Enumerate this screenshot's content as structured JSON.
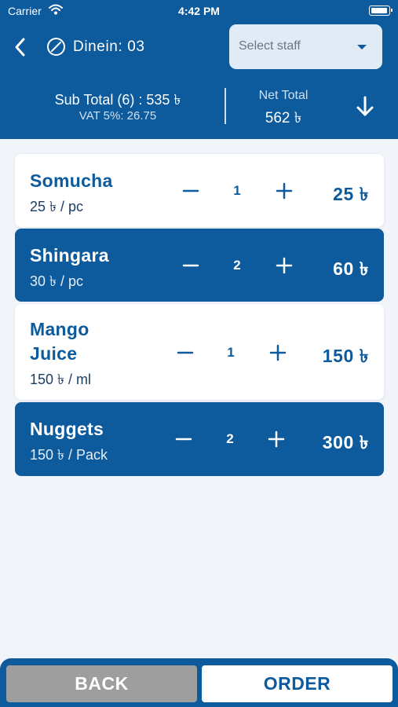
{
  "status_bar": {
    "carrier": "Carrier",
    "time": "4:42 PM"
  },
  "header": {
    "dine_label": "Dinein: 03",
    "staff_placeholder": "Select staff",
    "subtotal": "Sub Total (6)  : 535 ৳",
    "vat": "VAT 5%: 26.75",
    "net_total_label": "Net Total",
    "net_total_value": "562 ৳"
  },
  "cart": [
    {
      "name": "Somucha",
      "unit": "25 ৳ / pc",
      "qty": "1",
      "price": "25 ৳"
    },
    {
      "name": "Shingara",
      "unit": "30 ৳ / pc",
      "qty": "2",
      "price": "60 ৳"
    },
    {
      "name_line1": "Mango",
      "name_line2": "Juice",
      "unit": "150 ৳ / ml",
      "qty": "1",
      "price": "150 ৳"
    },
    {
      "name": "Nuggets",
      "unit": "150 ৳ / Pack",
      "qty": "2",
      "price": "300 ৳"
    }
  ],
  "footer": {
    "back_label": "BACK",
    "order_label": "ORDER"
  },
  "colors": {
    "primary": "#0d5a9c",
    "background": "#f1f4f9",
    "back_button": "#9e9e9e",
    "staff_select": "#e1ebf5"
  },
  "icons": [
    "wifi-icon",
    "battery-icon",
    "back-icon",
    "table-icon",
    "caret-down-icon",
    "arrow-down-icon",
    "minus-icon",
    "plus-icon"
  ]
}
